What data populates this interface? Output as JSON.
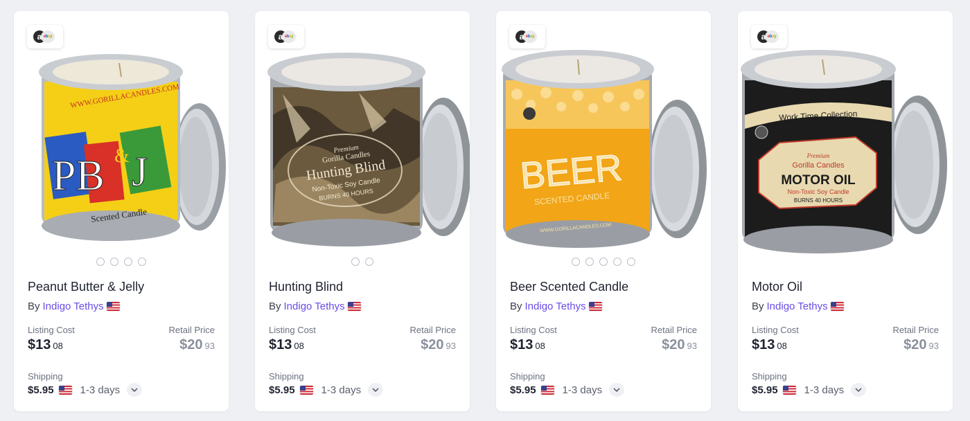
{
  "products": [
    {
      "title": "Peanut Butter & Jelly",
      "by_prefix": "By",
      "seller": "Indigo Tethys",
      "listing_cost_label": "Listing Cost",
      "listing_cost_dollars": "$13",
      "listing_cost_cents": "08",
      "retail_price_label": "Retail Price",
      "retail_price_dollars": "$20",
      "retail_price_cents": "93",
      "shipping_label": "Shipping",
      "shipping_price": "$5.95",
      "shipping_time": "1-3 days",
      "image_count": 4,
      "label_lines": [
        "WWW.GORILLACANDLES.COM",
        "PB",
        "&",
        "J",
        "Scented Candle"
      ],
      "colors": {
        "label": "#f4cf16",
        "accent1": "#2a5bc2",
        "accent2": "#d93027",
        "accent3": "#3a9a3a"
      }
    },
    {
      "title": "Hunting Blind",
      "by_prefix": "By",
      "seller": "Indigo Tethys",
      "listing_cost_label": "Listing Cost",
      "listing_cost_dollars": "$13",
      "listing_cost_cents": "08",
      "retail_price_label": "Retail Price",
      "retail_price_dollars": "$20",
      "retail_price_cents": "93",
      "shipping_label": "Shipping",
      "shipping_price": "$5.95",
      "shipping_time": "1-3 days",
      "image_count": 2,
      "label_lines": [
        "Premium",
        "Gorilla Candles",
        "Hunting Blind",
        "Non-Toxic Soy Candle",
        "BURNS 40 HOURS"
      ],
      "colors": {
        "label": "#6b5a3e",
        "accent1": "#3a3024",
        "accent2": "#a8916a",
        "accent3": "#d9c9a6"
      }
    },
    {
      "title": "Beer Scented Candle",
      "by_prefix": "By",
      "seller": "Indigo Tethys",
      "listing_cost_label": "Listing Cost",
      "listing_cost_dollars": "$13",
      "listing_cost_cents": "08",
      "retail_price_label": "Retail Price",
      "retail_price_dollars": "$20",
      "retail_price_cents": "93",
      "shipping_label": "Shipping",
      "shipping_price": "$5.95",
      "shipping_time": "1-3 days",
      "image_count": 5,
      "label_lines": [
        "BEER",
        "SCENTED CANDLE",
        "WWW.GORILLACANDLES.COM"
      ],
      "colors": {
        "label": "#f2a516",
        "accent1": "#f7c65a",
        "accent2": "#ffffff",
        "accent3": "#e08d0c"
      }
    },
    {
      "title": "Motor Oil",
      "by_prefix": "By",
      "seller": "Indigo Tethys",
      "listing_cost_label": "Listing Cost",
      "listing_cost_dollars": "$13",
      "listing_cost_cents": "08",
      "retail_price_label": "Retail Price",
      "retail_price_dollars": "$20",
      "retail_price_cents": "93",
      "shipping_label": "Shipping",
      "shipping_price": "$5.95",
      "shipping_time": "1-3 days",
      "image_count": 0,
      "label_lines": [
        "Work Time Collection",
        "Premium",
        "Gorilla Candles",
        "MOTOR OIL",
        "Non-Toxic Soy Candle",
        "BURNS 40 HOURS"
      ],
      "colors": {
        "label": "#1c1c1c",
        "accent1": "#e8d9b0",
        "accent2": "#c0392b",
        "accent3": "#1c1c1c"
      }
    }
  ],
  "marketplace_badge": {
    "amazon_letter": "a",
    "ebay_text": [
      "e",
      "b",
      "a",
      "y"
    ]
  },
  "icons": {
    "marketplace": "marketplace-badge-icon",
    "flag": "us-flag-icon",
    "expand": "chevron-down-icon"
  }
}
